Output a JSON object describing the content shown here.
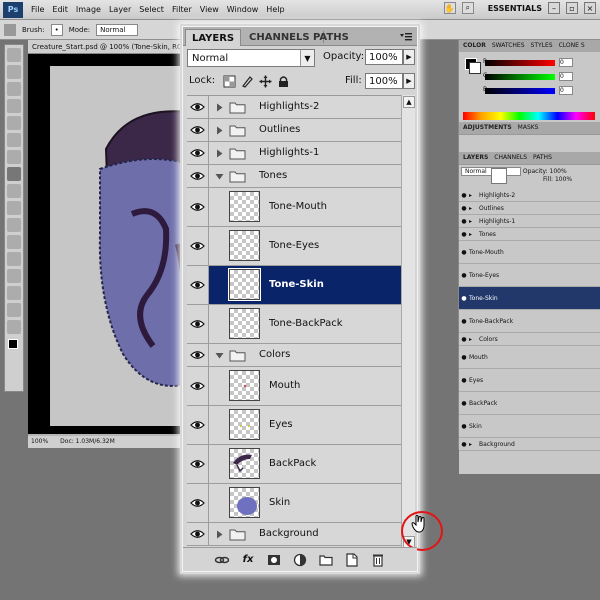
{
  "menubar": {
    "logo": "Ps",
    "items": [
      "File",
      "Edit",
      "Image",
      "Layer",
      "Select",
      "Filter",
      "View",
      "Window",
      "Help"
    ],
    "workspace": "ESSENTIALS"
  },
  "options": {
    "brush_label": "Brush:",
    "mode_label": "Mode:",
    "mode_value": "Normal"
  },
  "document": {
    "tab_title": "Creature_Start.psd @ 100% (Tone-Skin, RGB",
    "zoom": "100%",
    "doc_size": "Doc: 1.03M/6.32M"
  },
  "colors": {
    "selected_row": "#0a246a",
    "highlight_circle": "#e01515",
    "panel_bg": "#d4d4d4"
  },
  "right_panels": {
    "color_tabs": [
      "COLOR",
      "SWATCHES",
      "STYLES",
      "CLONE S"
    ],
    "adjust_tabs": [
      "ADJUSTMENTS",
      "MASKS"
    ],
    "layer_tabs": [
      "LAYERS",
      "CHANNELS",
      "PATHS"
    ],
    "mini_mode": "Normal",
    "mini_opacity_label": "Opacity:",
    "mini_opacity": "100%",
    "mini_fill_label": "Fill:",
    "mini_fill": "100%",
    "slider_values": [
      "0",
      "0",
      "0"
    ],
    "slider_labels": [
      "R",
      "G",
      "B"
    ]
  },
  "panel": {
    "tabs": [
      "LAYERS",
      "CHANNELS",
      "PATHS"
    ],
    "blend_mode": "Normal",
    "opacity_label": "Opacity:",
    "opacity_value": "100%",
    "lock_label": "Lock:",
    "fill_label": "Fill:",
    "fill_value": "100%",
    "layers": [
      {
        "name": "Highlights-2",
        "type": "group",
        "expanded": false
      },
      {
        "name": "Outlines",
        "type": "group",
        "expanded": false
      },
      {
        "name": "Highlights-1",
        "type": "group",
        "expanded": false
      },
      {
        "name": "Tones",
        "type": "group",
        "expanded": true
      },
      {
        "name": "Tone-Mouth",
        "type": "layer"
      },
      {
        "name": "Tone-Eyes",
        "type": "layer"
      },
      {
        "name": "Tone-Skin",
        "type": "layer",
        "selected": true
      },
      {
        "name": "Tone-BackPack",
        "type": "layer"
      },
      {
        "name": "Colors",
        "type": "group",
        "expanded": true
      },
      {
        "name": "Mouth",
        "type": "layer"
      },
      {
        "name": "Eyes",
        "type": "layer"
      },
      {
        "name": "BackPack",
        "type": "layer"
      },
      {
        "name": "Skin",
        "type": "layer"
      },
      {
        "name": "Background",
        "type": "group",
        "expanded": false
      }
    ],
    "footer_icons": [
      "link-icon",
      "fx-icon",
      "mask-icon",
      "adjustment-icon",
      "new-group-icon",
      "new-layer-icon",
      "trash-icon"
    ],
    "fx_label": "fx"
  }
}
